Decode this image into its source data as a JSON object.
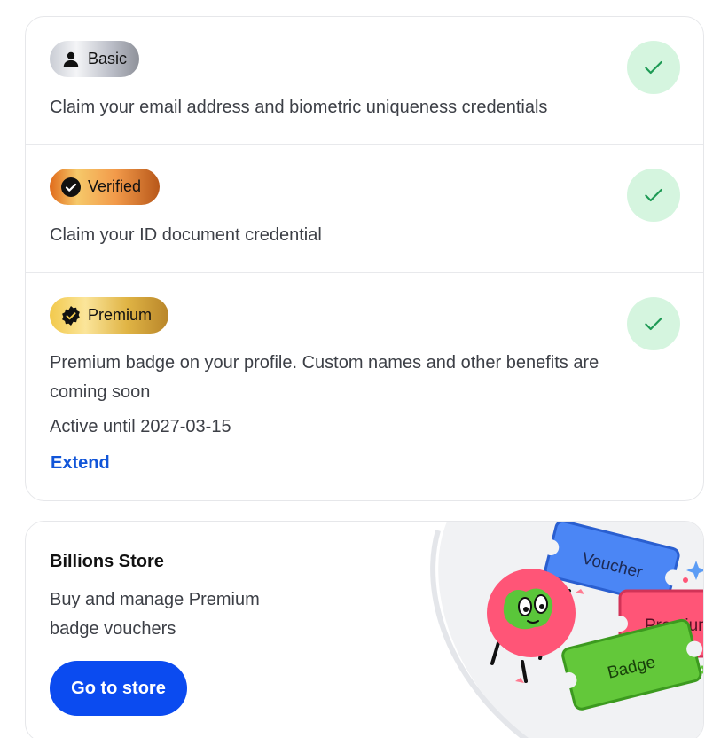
{
  "tiers": [
    {
      "badge_label": "Basic",
      "icon": "person-icon",
      "description": "Claim your email address and biometric uniqueness credentials",
      "status": "completed"
    },
    {
      "badge_label": "Verified",
      "icon": "check-circle-icon",
      "description": "Claim your ID document credential",
      "status": "completed"
    },
    {
      "badge_label": "Premium",
      "icon": "verified-seal-icon",
      "description": "Premium badge on your profile. Custom names and other benefits are coming soon",
      "active_until": "Active until 2027-03-15",
      "extend_label": "Extend",
      "status": "completed"
    }
  ],
  "store": {
    "title": "Billions Store",
    "description": "Buy and manage Premium badge vouchers",
    "button_label": "Go to store",
    "illustration": {
      "ticket_labels": [
        "Voucher",
        "Premium",
        "Badge"
      ]
    }
  },
  "colors": {
    "accent": "#0b4bf0",
    "link": "#1155d8",
    "check_bg": "#d5f5df",
    "check_stroke": "#1e9a55"
  }
}
